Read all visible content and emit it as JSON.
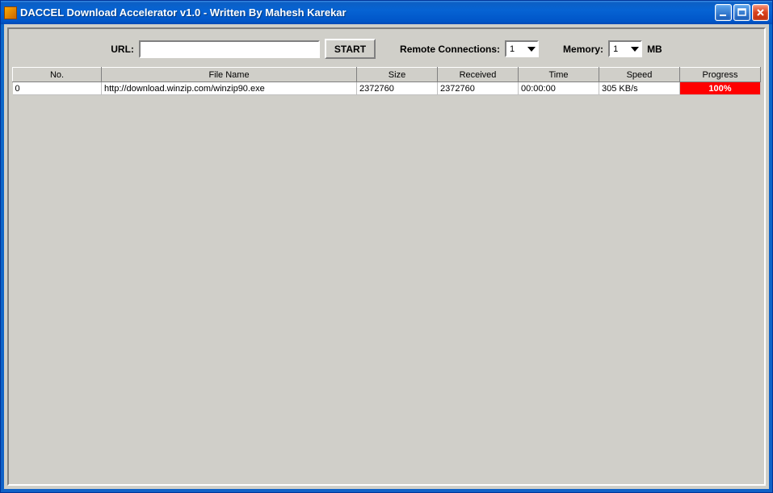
{
  "window": {
    "title": "DACCEL Download Accelerator v1.0 - Written By Mahesh Karekar"
  },
  "toolbar": {
    "url_label": "URL:",
    "url_value": "",
    "start_label": "START",
    "remote_label": "Remote Connections:",
    "remote_value": "1",
    "memory_label": "Memory:",
    "memory_value": "1",
    "memory_unit": "MB"
  },
  "table": {
    "headers": {
      "no": "No.",
      "file": "File Name",
      "size": "Size",
      "received": "Received",
      "time": "Time",
      "speed": "Speed",
      "progress": "Progress"
    },
    "rows": [
      {
        "no": "0",
        "file": "http://download.winzip.com/winzip90.exe",
        "size": "2372760",
        "received": "2372760",
        "time": "00:00:00",
        "speed": "305 KB/s",
        "progress": "100%"
      }
    ]
  }
}
